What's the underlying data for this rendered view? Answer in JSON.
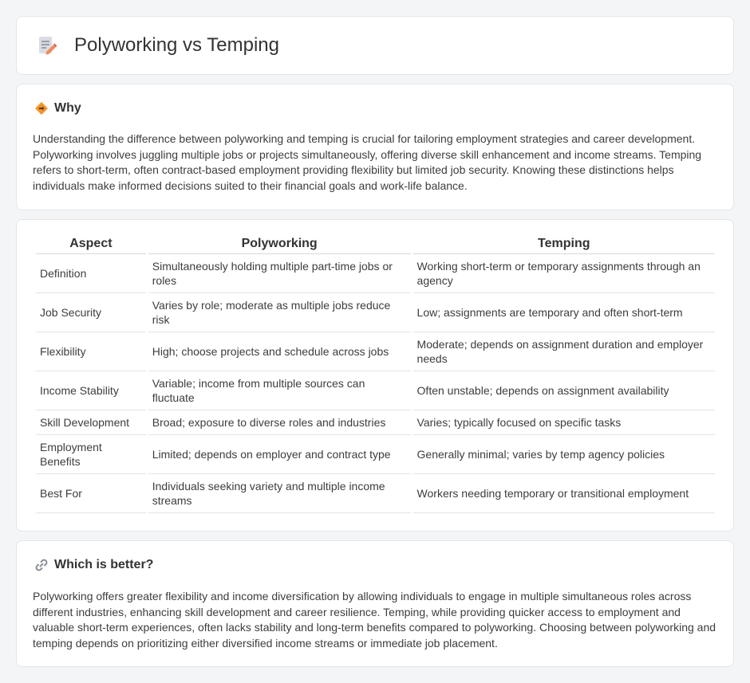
{
  "page": {
    "title": "Polyworking vs Temping"
  },
  "why": {
    "heading": "Why",
    "body": "Understanding the difference between polyworking and temping is crucial for tailoring employment strategies and career development. Polyworking involves juggling multiple jobs or projects simultaneously, offering diverse skill enhancement and income streams. Temping refers to short-term, often contract-based employment providing flexibility but limited job security. Knowing these distinctions helps individuals make informed decisions suited to their financial goals and work-life balance."
  },
  "table": {
    "headers": [
      "Aspect",
      "Polyworking",
      "Temping"
    ],
    "rows": [
      [
        "Definition",
        "Simultaneously holding multiple part-time jobs or roles",
        "Working short-term or temporary assignments through an agency"
      ],
      [
        "Job Security",
        "Varies by role; moderate as multiple jobs reduce risk",
        "Low; assignments are temporary and often short-term"
      ],
      [
        "Flexibility",
        "High; choose projects and schedule across jobs",
        "Moderate; depends on assignment duration and employer needs"
      ],
      [
        "Income Stability",
        "Variable; income from multiple sources can fluctuate",
        "Often unstable; depends on assignment availability"
      ],
      [
        "Skill Development",
        "Broad; exposure to diverse roles and industries",
        "Varies; typically focused on specific tasks"
      ],
      [
        "Employment Benefits",
        "Limited; depends on employer and contract type",
        "Generally minimal; varies by temp agency policies"
      ],
      [
        "Best For",
        "Individuals seeking variety and multiple income streams",
        "Workers needing temporary or transitional employment"
      ]
    ]
  },
  "better": {
    "heading": "Which is better?",
    "body": "Polyworking offers greater flexibility and income diversification by allowing individuals to engage in multiple simultaneous roles across different industries, enhancing skill development and career resilience. Temping, while providing quicker access to employment and valuable short-term experiences, often lacks stability and long-term benefits compared to polyworking. Choosing between polyworking and temping depends on prioritizing either diversified income streams or immediate job placement."
  },
  "icons": {
    "header": "document-pencil-icon",
    "why": "diamond-signpost-icon",
    "better": "link-icon"
  },
  "colors": {
    "accent_orange": "#f0932b",
    "icon_pink": "#e8a0a8"
  }
}
